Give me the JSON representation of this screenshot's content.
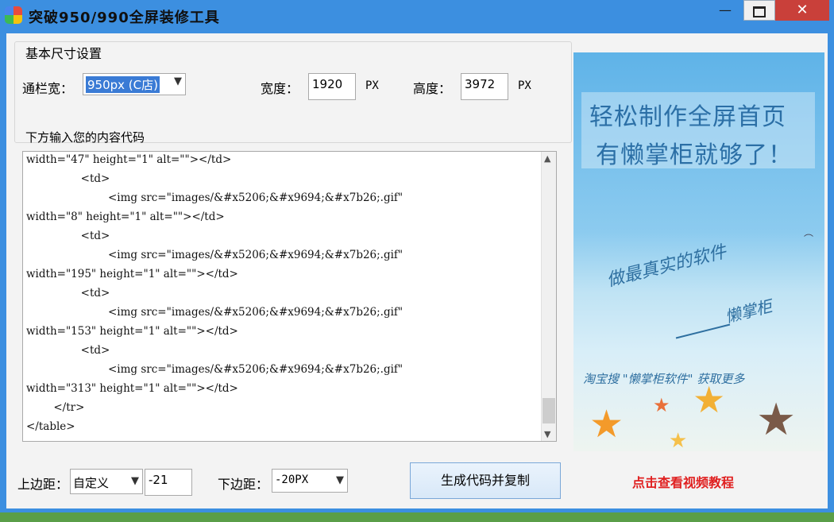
{
  "window": {
    "title": "突破950/990全屏装修工具",
    "minimize": "—",
    "close": "✕"
  },
  "settings": {
    "group_title": "基本尺寸设置",
    "channel_label": "通栏宽：",
    "channel_value": "950px (C店)",
    "width_label": "宽度：",
    "width_value": "1920",
    "width_unit": "PX",
    "height_label": "高度：",
    "height_value": "3972",
    "height_unit": "PX"
  },
  "code": {
    "label": "下方输入您的内容代码",
    "lines": [
      "width=\"47\" height=\"1\" alt=\"\"></td>",
      "                <td>",
      "                        <img src=\"images/&#x5206;&#x9694;&#x7b26;.gif\"",
      "width=\"8\" height=\"1\" alt=\"\"></td>",
      "                <td>",
      "                        <img src=\"images/&#x5206;&#x9694;&#x7b26;.gif\"",
      "width=\"195\" height=\"1\" alt=\"\"></td>",
      "                <td>",
      "                        <img src=\"images/&#x5206;&#x9694;&#x7b26;.gif\"",
      "width=\"153\" height=\"1\" alt=\"\"></td>",
      "                <td>",
      "                        <img src=\"images/&#x5206;&#x9694;&#x7b26;.gif\"",
      "width=\"313\" height=\"1\" alt=\"\"></td>",
      "        </tr>",
      "</table>"
    ]
  },
  "bottom": {
    "top_margin_label": "上边距：",
    "top_margin_select": "自定义",
    "top_margin_value": "-21",
    "bottom_margin_label": "下边距：",
    "bottom_margin_select": "-20PX",
    "generate_button": "生成代码并复制",
    "video_link": "点击查看视频教程"
  },
  "ad": {
    "line1": "轻松制作全屏首页",
    "line2": "有懒掌柜就够了！",
    "slogan": "做最真实的软件",
    "signature": "懒掌柜",
    "footer": "淘宝搜 \"懒掌柜软件\" 获取更多"
  }
}
